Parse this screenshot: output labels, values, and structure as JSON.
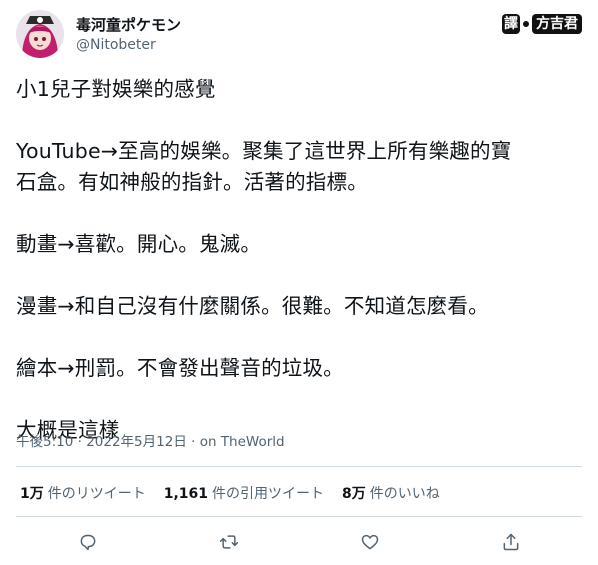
{
  "author": {
    "display_name": "毒河童ポケモン",
    "handle": "@Nitobeter",
    "avatar_icon": "avatar-anime-girl-icon"
  },
  "translator_badge": {
    "left": "譯",
    "right": "方吉君"
  },
  "tweet": {
    "lines": [
      "小1兒子對娛樂的感覺",
      "",
      "YouTube→至高的娛樂。聚集了這世界上所有樂趣的寶",
      "石盒。有如神般的指針。活著的指標。",
      "",
      "動畫→喜歡。開心。鬼滅。",
      "",
      "漫畫→和自己沒有什麼關係。很難。不知道怎麼看。",
      "",
      "繪本→刑罰。不會發出聲音的垃圾。",
      "",
      "大概是這樣"
    ]
  },
  "meta": {
    "time": "午後5:10",
    "separator": " · ",
    "date": "2022年5月12日",
    "via": " · on TheWorld"
  },
  "stats": [
    {
      "num": "1万",
      "label": "件のリツイート"
    },
    {
      "num": "1,161",
      "label": "件の引用ツイート"
    },
    {
      "num": "8万",
      "label": "件のいいね"
    }
  ],
  "actions": {
    "icons": [
      "reply-icon",
      "retweet-icon",
      "like-icon",
      "share-icon"
    ]
  },
  "colors": {
    "text": "#0f1419",
    "secondary": "#536471",
    "divider": "#cfd9de"
  }
}
